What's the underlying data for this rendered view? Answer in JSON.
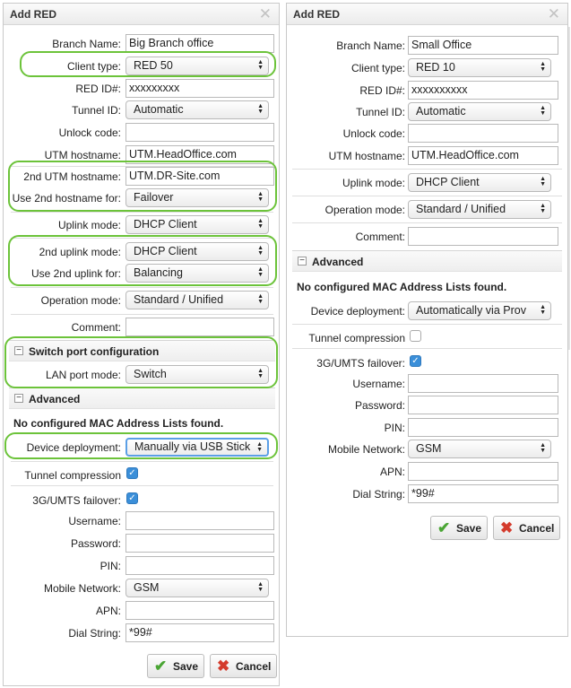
{
  "left": {
    "title": "Add RED",
    "fields": {
      "branch_name": {
        "label": "Branch Name:",
        "value": "Big Branch office"
      },
      "client_type": {
        "label": "Client type:",
        "value": "RED 50"
      },
      "red_id": {
        "label": "RED ID#:",
        "value": "xxxxxxxxx"
      },
      "tunnel_id": {
        "label": "Tunnel ID:",
        "value": "Automatic"
      },
      "unlock_code": {
        "label": "Unlock code:",
        "value": ""
      },
      "utm_hostname": {
        "label": "UTM hostname:",
        "value": "UTM.HeadOffice.com"
      },
      "utm_hostname2": {
        "label": "2nd UTM hostname:",
        "value": "UTM.DR-Site.com"
      },
      "use_2nd_hostname": {
        "label": "Use 2nd hostname for:",
        "value": "Failover"
      },
      "uplink_mode": {
        "label": "Uplink mode:",
        "value": "DHCP Client"
      },
      "uplink_mode2": {
        "label": "2nd uplink mode:",
        "value": "DHCP Client"
      },
      "use_2nd_uplink": {
        "label": "Use 2nd uplink for:",
        "value": "Balancing"
      },
      "operation_mode": {
        "label": "Operation mode:",
        "value": "Standard / Unified"
      },
      "comment": {
        "label": "Comment:",
        "value": ""
      },
      "switch_port_title": "Switch port configuration",
      "lan_port_mode": {
        "label": "LAN port mode:",
        "value": "Switch"
      },
      "advanced_title": "Advanced",
      "no_mac_note": "No configured MAC Address Lists found.",
      "device_deployment": {
        "label": "Device deployment:",
        "value": "Manually via USB Stick"
      },
      "tunnel_compression": {
        "label": "Tunnel compression",
        "checked": true
      },
      "umts_failover": {
        "label": "3G/UMTS failover:",
        "checked": true
      },
      "username": {
        "label": "Username:",
        "value": ""
      },
      "password": {
        "label": "Password:",
        "value": ""
      },
      "pin": {
        "label": "PIN:",
        "value": ""
      },
      "mobile_network": {
        "label": "Mobile Network:",
        "value": "GSM"
      },
      "apn": {
        "label": "APN:",
        "value": ""
      },
      "dial_string": {
        "label": "Dial String:",
        "value": "*99#"
      }
    },
    "save_label": "Save",
    "cancel_label": "Cancel"
  },
  "right": {
    "title": "Add RED",
    "fields": {
      "branch_name": {
        "label": "Branch Name:",
        "value": "Small Office"
      },
      "client_type": {
        "label": "Client type:",
        "value": "RED 10"
      },
      "red_id": {
        "label": "RED ID#:",
        "value": "xxxxxxxxxx"
      },
      "tunnel_id": {
        "label": "Tunnel ID:",
        "value": "Automatic"
      },
      "unlock_code": {
        "label": "Unlock code:",
        "value": ""
      },
      "utm_hostname": {
        "label": "UTM hostname:",
        "value": "UTM.HeadOffice.com"
      },
      "uplink_mode": {
        "label": "Uplink mode:",
        "value": "DHCP Client"
      },
      "operation_mode": {
        "label": "Operation mode:",
        "value": "Standard / Unified"
      },
      "comment": {
        "label": "Comment:",
        "value": ""
      },
      "advanced_title": "Advanced",
      "no_mac_note": "No configured MAC Address Lists found.",
      "device_deployment": {
        "label": "Device deployment:",
        "value": "Automatically via Prov"
      },
      "tunnel_compression": {
        "label": "Tunnel compression",
        "checked": false
      },
      "umts_failover": {
        "label": "3G/UMTS failover:",
        "checked": true
      },
      "username": {
        "label": "Username:",
        "value": ""
      },
      "password": {
        "label": "Password:",
        "value": ""
      },
      "pin": {
        "label": "PIN:",
        "value": ""
      },
      "mobile_network": {
        "label": "Mobile Network:",
        "value": "GSM"
      },
      "apn": {
        "label": "APN:",
        "value": ""
      },
      "dial_string": {
        "label": "Dial String:",
        "value": "*99#"
      }
    },
    "save_label": "Save",
    "cancel_label": "Cancel"
  },
  "colors": {
    "highlight": "#6cc33a",
    "checkbox": "#3b8fd9",
    "save_icon": "#4aa534",
    "cancel_icon": "#d43b2c"
  },
  "icons": [
    "close-icon",
    "checkmark-icon",
    "cross-icon",
    "collapse-icon",
    "dropdown-arrows-icon"
  ]
}
